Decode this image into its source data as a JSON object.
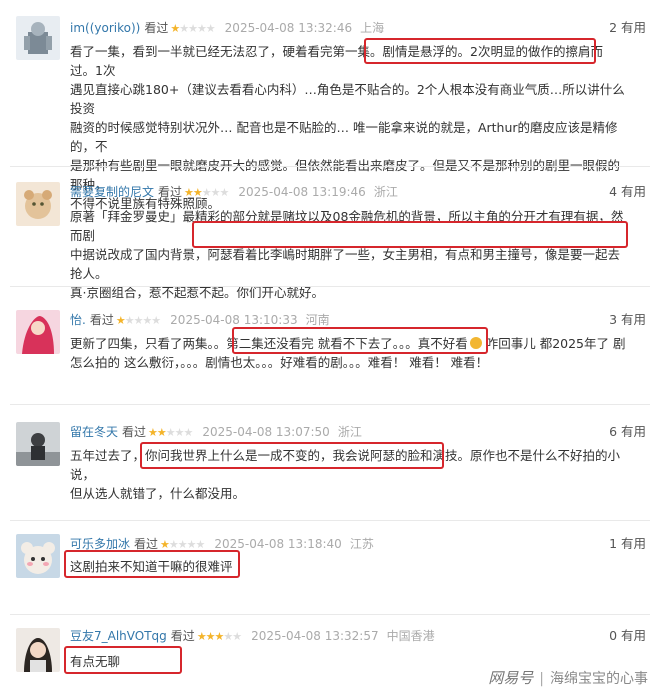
{
  "reviews": [
    {
      "user": "im((yoriko))",
      "watched": "看过",
      "rating": 1,
      "date": "2025-04-08 13:32:46",
      "location": "上海",
      "useful": "2 有用",
      "lines": [
        "看了一集，看到一半就已经无法忍了，硬着看完第一集。剧情是悬浮的。2次明显的做作的擦肩而过。1次",
        "遇见直接心跳180+（建议去看看心内科）…角色是不贴合的。2个人根本没有商业气质…所以讲什么投资",
        "融资的时候感觉特别状况外… 配音也是不贴脸的… 唯一能拿来说的就是，Arthur的磨皮应该是精修的，不",
        "是那种有些剧里一眼就磨皮开大的感觉。但依然能看出来磨皮了。但是又不是那种别的剧里一眼假的那种，",
        "不得不说里族有特殊照顾。"
      ]
    },
    {
      "user": "需要复制的尼文",
      "watched": "看过",
      "rating": 2,
      "date": "2025-04-08 13:19:46",
      "location": "浙江",
      "useful": "4 有用",
      "lines": [
        "原著「拜金罗曼史」最精彩的部分就是赌坟以及08金融危机的背景，所以主角的分开才有理有据，然而剧",
        "中据说改成了国内背景，阿瑟看着比李嶋时期胖了一些，女主男相，有点和男主撞号，像是要一起去抢人。",
        "真·京圈组合，惹不起惹不起。你们开心就好。"
      ]
    },
    {
      "user": "怡.",
      "watched": "看过",
      "rating": 1,
      "date": "2025-04-08 13:10:33",
      "location": "河南",
      "useful": "3 有用",
      "lines": [
        "更新了四集，只看了两集。。第二集还没看完 就看不下去了。。。真不好看",
        "怎么拍的 这么敷衍，。。。剧情也太。。。好难看的剧。。。难看！ 难看！ 难看！"
      ],
      "line1_tail": "咋回事儿 都2025年了 剧"
    },
    {
      "user": "留在冬天",
      "watched": "看过",
      "rating": 2,
      "date": "2025-04-08 13:07:50",
      "location": "浙江",
      "useful": "6 有用",
      "lines": [
        "五年过去了，你问我世界上什么是一成不变的，我会说阿瑟的脸和演技。原作也不是什么不好拍的小说，",
        "但从选人就错了，什么都没用。"
      ]
    },
    {
      "user": "可乐多加冰",
      "watched": "看过",
      "rating": 1,
      "date": "2025-04-08 13:18:40",
      "location": "江苏",
      "useful": "1 有用",
      "lines": [
        "这剧拍来不知道干嘛的很难评"
      ]
    },
    {
      "user": "豆友7_AlhVOTqg",
      "watched": "看过",
      "rating": 3,
      "date": "2025-04-08 13:32:57",
      "location": "中国香港",
      "useful": "0 有用",
      "lines": [
        "有点无聊"
      ]
    }
  ],
  "watermark": {
    "brand": "网易号",
    "account": "海绵宝宝的心事"
  },
  "colors": {
    "username": "#3377aa",
    "star": "#f4b42a",
    "highlight_box": "#d6262c"
  }
}
